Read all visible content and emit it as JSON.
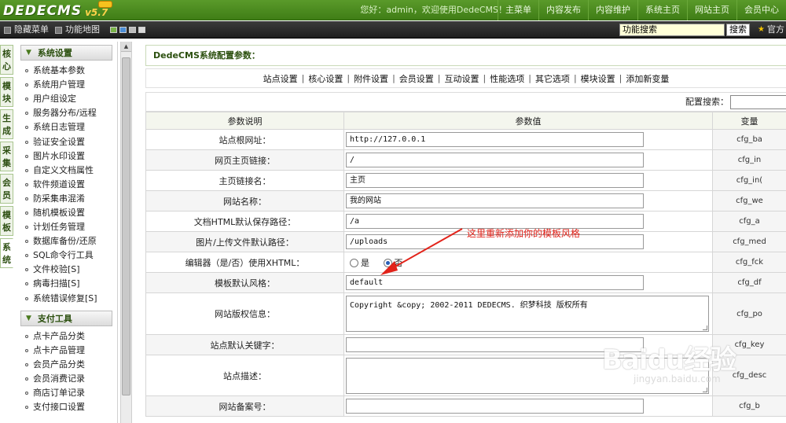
{
  "header": {
    "logo_text": "DEDECMS",
    "logo_version": "v5.7",
    "welcome": "您好：admin，欢迎使用DedeCMS！",
    "nav": [
      "主菜单",
      "内容发布",
      "内容维护",
      "系统主页",
      "网站主页",
      "会员中心"
    ]
  },
  "toolbar": {
    "hide_menu": "隐藏菜单",
    "function_map": "功能地图",
    "search_value": "功能搜索",
    "search_button": "搜索",
    "official": "官方"
  },
  "vtabs": [
    "核心",
    "模块",
    "生成",
    "采集",
    "会员",
    "模板",
    "系统"
  ],
  "sidebar": {
    "group1": {
      "title": "系统设置",
      "items": [
        "系统基本参数",
        "系统用户管理",
        "用户组设定",
        "服务器分布/远程",
        "系统日志管理",
        "验证安全设置",
        "图片水印设置",
        "自定义文档属性",
        "软件频道设置",
        "防采集串混淆",
        "随机模板设置",
        "计划任务管理",
        "数据库备份/还原",
        "SQL命令行工具",
        "文件校验[S]",
        "病毒扫描[S]",
        "系统错误修复[S]"
      ]
    },
    "group2": {
      "title": "支付工具",
      "items": [
        "点卡产品分类",
        "点卡产品管理",
        "会员产品分类",
        "会员消费记录",
        "商店订单记录",
        "支付接口设置"
      ]
    }
  },
  "main": {
    "title": "DedeCMS系统配置参数：",
    "tabs": [
      "站点设置",
      "核心设置",
      "附件设置",
      "会员设置",
      "互动设置",
      "性能选项",
      "其它选项",
      "模块设置",
      "添加新变量"
    ],
    "config_search_label": "配置搜索：",
    "columns": [
      "参数说明",
      "参数值",
      "变量"
    ],
    "rows": [
      {
        "label": "站点根网址：",
        "value": "http://127.0.0.1",
        "var": "cfg_ba"
      },
      {
        "label": "网页主页链接：",
        "value": "/",
        "var": "cfg_in"
      },
      {
        "label": "主页链接名：",
        "value": "主页",
        "var": "cfg_in("
      },
      {
        "label": "网站名称：",
        "value": "我的网站",
        "var": "cfg_we"
      },
      {
        "label": "文档HTML默认保存路径：",
        "value": "/a",
        "var": "cfg_a"
      },
      {
        "label": "图片/上传文件默认路径：",
        "value": "/uploads",
        "var": "cfg_med"
      },
      {
        "label": "编辑器（是/否）使用XHTML：",
        "radio_yes": "是",
        "radio_no": "否",
        "var": "cfg_fck"
      },
      {
        "label": "模板默认风格：",
        "value": "default",
        "var": "cfg_df"
      },
      {
        "label": "网站版权信息：",
        "value": "Copyright &copy; 2002-2011 DEDECMS. 织梦科技 版权所有",
        "var": "cfg_po"
      },
      {
        "label": "站点默认关键字：",
        "value": "",
        "var": "cfg_key"
      },
      {
        "label": "站点描述：",
        "value": "",
        "var": "cfg_desc"
      },
      {
        "label": "网站备案号：",
        "value": "",
        "var": "cfg_b"
      }
    ]
  },
  "annotation": {
    "text": "这里重新添加你的模板风格",
    "color": "#e2231a"
  },
  "watermark": {
    "main": "Baidu经验",
    "sub": "jingyan.baidu.com"
  }
}
